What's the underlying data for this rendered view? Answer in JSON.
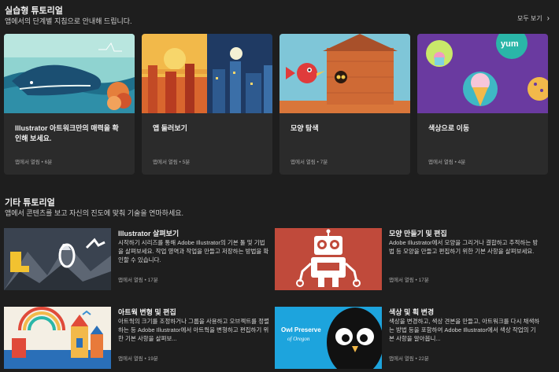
{
  "hands_on": {
    "title": "실습형 튜토리얼",
    "subtitle": "앱에서의 단계별 지침으로 안내해 드립니다.",
    "see_all": "모두 보기",
    "cards": [
      {
        "title": "Illustrator 아트워크만의 매력을 확인해 보세요.",
        "meta": "앱에서 열림 • 6분"
      },
      {
        "title": "앱 둘러보기",
        "meta": "앱에서 열림 • 5분"
      },
      {
        "title": "모양 탐색",
        "meta": "앱에서 열림 • 7분"
      },
      {
        "title": "색상으로 이동",
        "meta": "앱에서 열림 • 4분",
        "thumb_text": "yum"
      }
    ]
  },
  "other": {
    "title": "기타 튜토리얼",
    "subtitle": "앱에서 콘텐츠를 보고 자신의 진도에 맞춰 기술을 연마하세요.",
    "items": [
      {
        "title": "Illustrator 살펴보기",
        "desc": "시작하기 시리즈를 통해 Adobe Illustrator의 기본 툴 및 기법을 살펴보세요. 작업 영역과 작업을 만들고 저장하는 방법을 확인할 수 있습니다.",
        "meta": "앱에서 열림 • 17분"
      },
      {
        "title": "모양 만들기 및 편집",
        "desc": "Adobe Illustrator에서 모양을 그리거나 결합하고 추적하는 방법 등 모양을 만들고 편집하기 위한 기본 사항을 살펴보세요.",
        "meta": "앱에서 열림 • 17분"
      },
      {
        "title": "아트웍 변형 및 편집",
        "desc": "아트웍의 크기를 조정하거나 그룹을 사용하고 오브젝트를 정렬하는 등 Adobe Illustrator에서 아트웍을 변형하고 편집하기 위한 기본 사항을 살펴보...",
        "meta": "앱에서 열림 • 19분"
      },
      {
        "title": "색상 및 획 변경",
        "desc": "색상을 변경하고, 색상 견본을 만들고, 아트워크를 다시 채색하는 방법 등을 포함하여 Adobe Illustrator에서 색상 작업의 기본 사항을 알아봅니...",
        "meta": "앱에서 열림 • 22분",
        "thumb_text_1": "Owl Preserve",
        "thumb_text_2": "of Oregon"
      }
    ]
  },
  "colors": {
    "background": "#1e1e1e",
    "card": "#2b2b2b"
  }
}
